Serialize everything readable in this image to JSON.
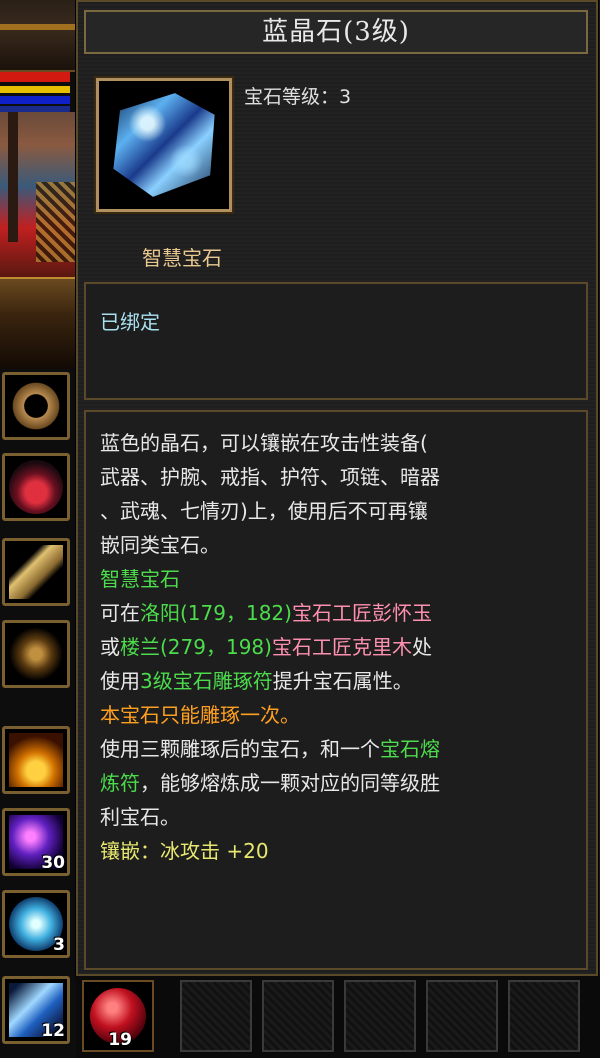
{
  "tooltip": {
    "title": "蓝晶石(3级)",
    "gem_level": "宝石等级：3",
    "gem_type": "智慧宝石",
    "bind_status": "已绑定",
    "desc_line1": "蓝色的晶石，可以镶嵌在攻击性装备(",
    "desc_line2": "武器、护腕、戒指、护符、项链、暗器",
    "desc_line3": "、武魂、七情刃)上，使用后不可再镶",
    "desc_line4": "嵌同类宝石。",
    "category": "智慧宝石",
    "loc1_prefix": "可在",
    "loc1_city": "洛阳(179，182)",
    "loc1_npc": "宝石工匠彭怀玉",
    "loc2_prefix": "或",
    "loc2_city": "楼兰(279，198)",
    "loc2_npc": "宝石工匠克里木",
    "loc2_suffix": "处",
    "use_prefix": "使用",
    "use_item": "3级宝石雕琢符",
    "use_suffix": "提升宝石属性。",
    "carve_once": "本宝石只能雕琢一次。",
    "fuse_prefix": "使用三颗雕琢后的宝石，和一个",
    "fuse_item_a": "宝石熔",
    "fuse_item_b": "炼符",
    "fuse_suffix_a": "，能够熔炼成一颗对应的同等级胜",
    "fuse_suffix_b": "利宝石。",
    "inlay": "镶嵌：冰攻击 +20"
  },
  "sidebar_slots": [
    {
      "icon": "ring-icon",
      "count": ""
    },
    {
      "icon": "necklace-icon",
      "count": ""
    },
    {
      "icon": "hidden-weapon-icon",
      "count": ""
    },
    {
      "icon": "dragon-icon",
      "count": ""
    },
    {
      "icon": "gold-pile-icon",
      "count": ""
    },
    {
      "icon": "purple-orb-icon",
      "count": "30"
    },
    {
      "icon": "blue-swirl-icon",
      "count": "3"
    },
    {
      "icon": "blue-gem-icon",
      "count": "12"
    }
  ],
  "hotbar": {
    "slot1_icon": "red-orb-icon",
    "slot1_count": "19"
  },
  "colors": {
    "green": "#4cdc4c",
    "pink": "#ff90b0",
    "orange": "#ffa020",
    "yellow": "#e8e870",
    "bind_cyan": "#a8e0f0",
    "type_tan": "#e8c890",
    "frame": "#7a6840"
  }
}
